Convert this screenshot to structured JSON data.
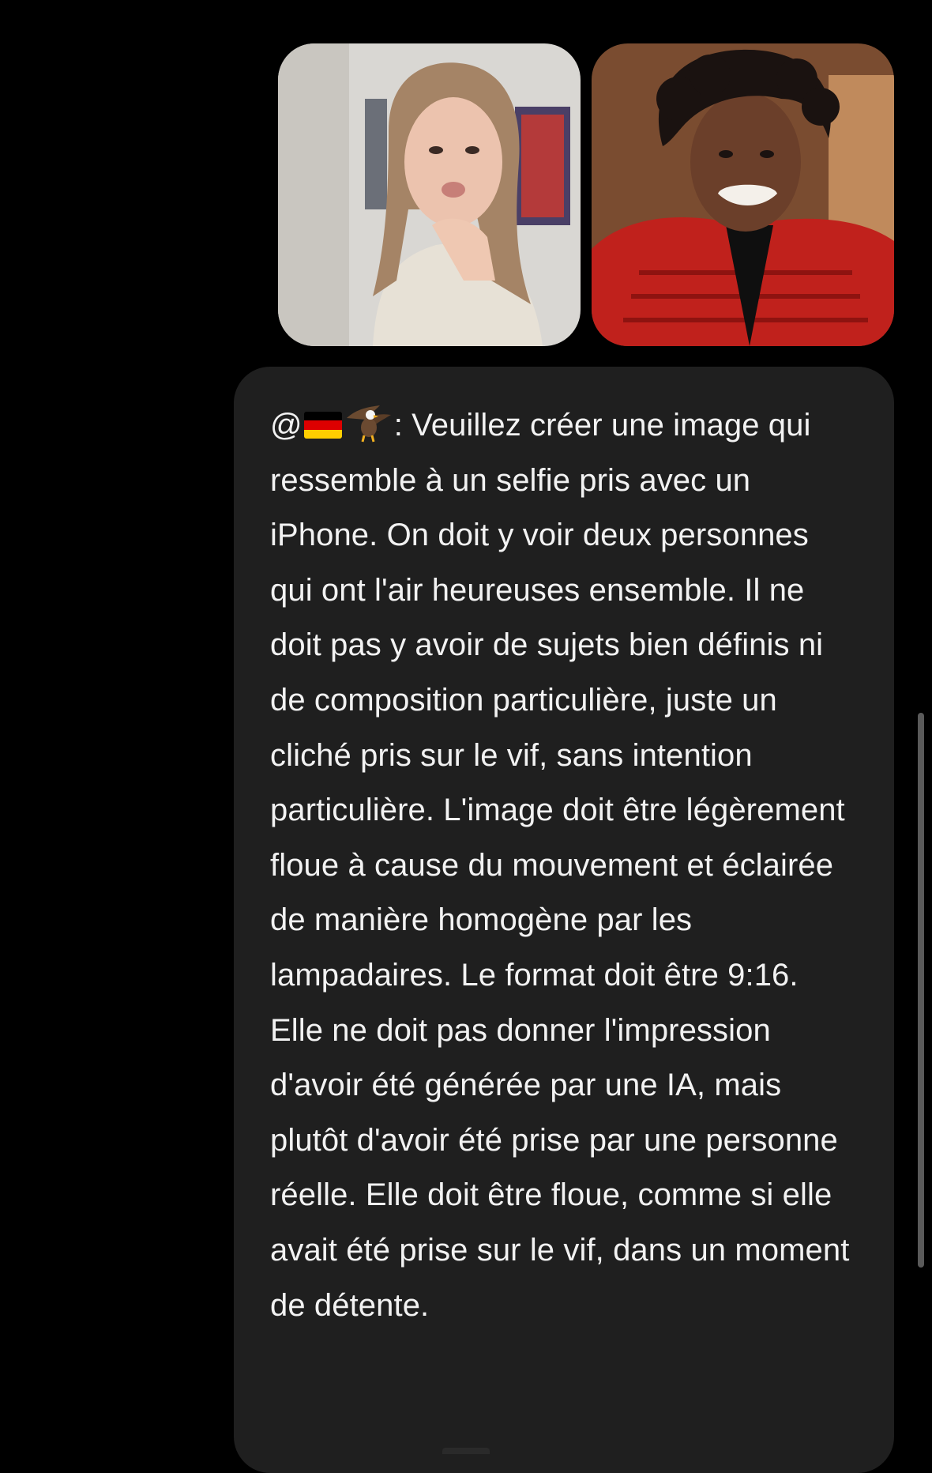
{
  "attachments": [
    {
      "icon": "photo-thumbnail"
    },
    {
      "icon": "photo-thumbnail"
    }
  ],
  "message": {
    "mention_prefix": "@",
    "mention_icons": [
      "german-flag-icon",
      "eagle-icon"
    ],
    "mention_suffix": ": ",
    "text": "Veuillez créer une image qui ressemble à un selfie pris avec un iPhone. On doit y voir deux personnes qui ont l'air heureuses ensemble. Il ne doit pas y avoir de sujets bien définis ni de composition particulière, juste un cliché pris sur le vif, sans intention particulière. L'image doit être légèrement floue à cause du mouvement et éclairée de manière homogène par les lampadaires. Le format doit être 9:16. Elle ne doit pas donner l'impression d'avoir été générée par une IA, mais plutôt d'avoir été prise par une personne réelle. Elle doit être floue, comme si elle avait été prise sur le vif, dans un moment de détente."
  },
  "colors": {
    "background": "#000000",
    "bubble": "#1f1f1f",
    "text": "#f2f2f2",
    "scrollbar": "#5a5a5a"
  }
}
